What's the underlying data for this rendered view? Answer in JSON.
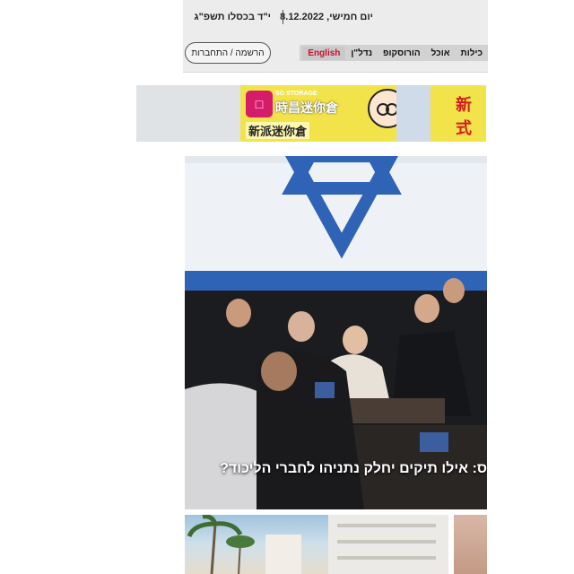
{
  "header": {
    "date_gregorian": "יום חמישי, 8.12.2022",
    "date_hebrew": "י\"ד בכסלו תשפ\"ג",
    "nav_items": [
      "כילות",
      "אוכל",
      "הורוסקופ",
      "נדל\"ן"
    ],
    "english_label": "English",
    "login_label": "הרשמה / התחברות"
  },
  "ad": {
    "brand_en": "SG STORAGE",
    "brand": "時昌迷你倉",
    "slogan": "新派迷你倉",
    "side_text": "新式"
  },
  "hero": {
    "headline": "ס: אילו תיקים יחלק נתניהו לחברי הליכוד?"
  },
  "colors": {
    "flag_blue": "#2f63b6",
    "english_red": "#c8102e",
    "ad_yellow": "#f3e34a"
  }
}
